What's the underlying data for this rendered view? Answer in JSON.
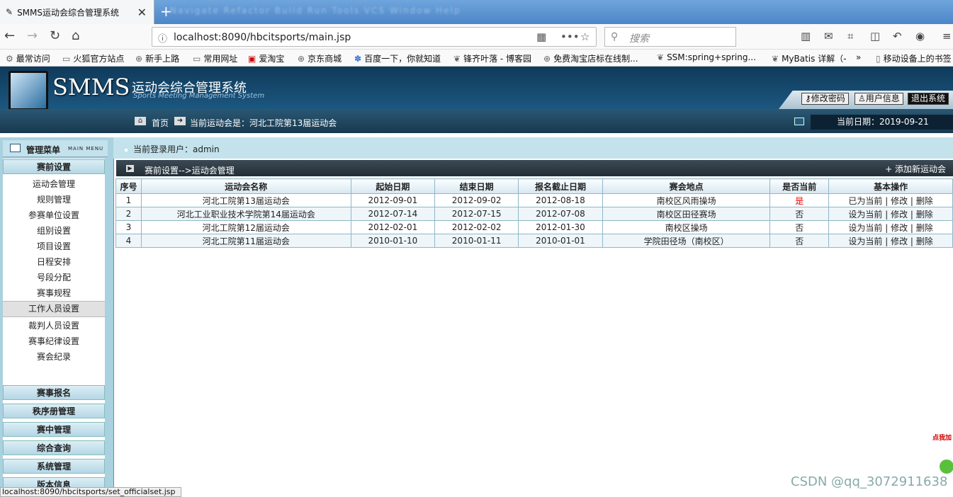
{
  "browser": {
    "tab_title": "SMMS运动会综合管理系统",
    "url": "localhost:8090/hbcitsports/main.jsp",
    "search_placeholder": "搜索",
    "status_url": "localhost:8090/hbcitsports/set_officialset.jsp",
    "bookmarks": [
      "最常访问",
      "火狐官方站点",
      "新手上路",
      "常用网址",
      "爱淘宝",
      "京东商城",
      "百度一下，你就知道",
      "锋齐叶落 - 博客园",
      "免费淘宝店标在线制...",
      "SSM:spring+spring...",
      "MyBatis 详解（-",
      "移动设备上的书签"
    ]
  },
  "header": {
    "logo_big": "SMMS",
    "logo_cn": "运动会综合管理系统",
    "logo_en": "Sports Meeting Management System",
    "btn_change_pwd": "修改密码",
    "btn_user_info": "用户信息",
    "btn_logout": "退出系统"
  },
  "crumb": {
    "home": "首页",
    "current_meeting": "当前运动会是：河北工院第13届运动会",
    "date": "当前日期：2019-09-21"
  },
  "sidebar": {
    "title": "管理菜单",
    "title_en": "MAIN MENU",
    "group_pre": "赛前设置",
    "items": [
      "运动会管理",
      "规则管理",
      "参赛单位设置",
      "组别设置",
      "项目设置",
      "日程安排",
      "号段分配",
      "赛事规程",
      "工作人员设置",
      "裁判人员设置",
      "赛事纪律设置",
      "赛会纪录"
    ],
    "groups": [
      "赛事报名",
      "秩序册管理",
      "赛中管理",
      "综合查询",
      "系统管理",
      "版本信息"
    ]
  },
  "main": {
    "login_user": "当前登录用户：admin",
    "path": "赛前设置-->运动会管理",
    "add_link": "+ 添加新运动会",
    "headers": [
      "序号",
      "运动会名称",
      "起始日期",
      "结束日期",
      "报名截止日期",
      "赛会地点",
      "是否当前",
      "基本操作"
    ],
    "rows": [
      {
        "no": "1",
        "name": "河北工院第13届运动会",
        "start": "2012-09-01",
        "end": "2012-09-02",
        "deadline": "2012-08-18",
        "place": "南校区风雨操场",
        "current": "是",
        "op_set": "已为当前",
        "op_edit": "修改",
        "op_del": "删除"
      },
      {
        "no": "2",
        "name": "河北工业职业技术学院第14届运动会",
        "start": "2012-07-14",
        "end": "2012-07-15",
        "deadline": "2012-07-08",
        "place": "南校区田径赛场",
        "current": "否",
        "op_set": "设为当前",
        "op_edit": "修改",
        "op_del": "删除"
      },
      {
        "no": "3",
        "name": "河北工院第12届运动会",
        "start": "2012-02-01",
        "end": "2012-02-02",
        "deadline": "2012-01-30",
        "place": "南校区操场",
        "current": "否",
        "op_set": "设为当前",
        "op_edit": "修改",
        "op_del": "删除"
      },
      {
        "no": "4",
        "name": "河北工院第11届运动会",
        "start": "2010-01-10",
        "end": "2010-01-11",
        "deadline": "2010-01-01",
        "place": "学院田径场（南校区）",
        "current": "否",
        "op_set": "设为当前",
        "op_edit": "修改",
        "op_del": "删除"
      }
    ]
  },
  "watermark": "CSDN @qq_3072911638",
  "float_tag": "点我加"
}
